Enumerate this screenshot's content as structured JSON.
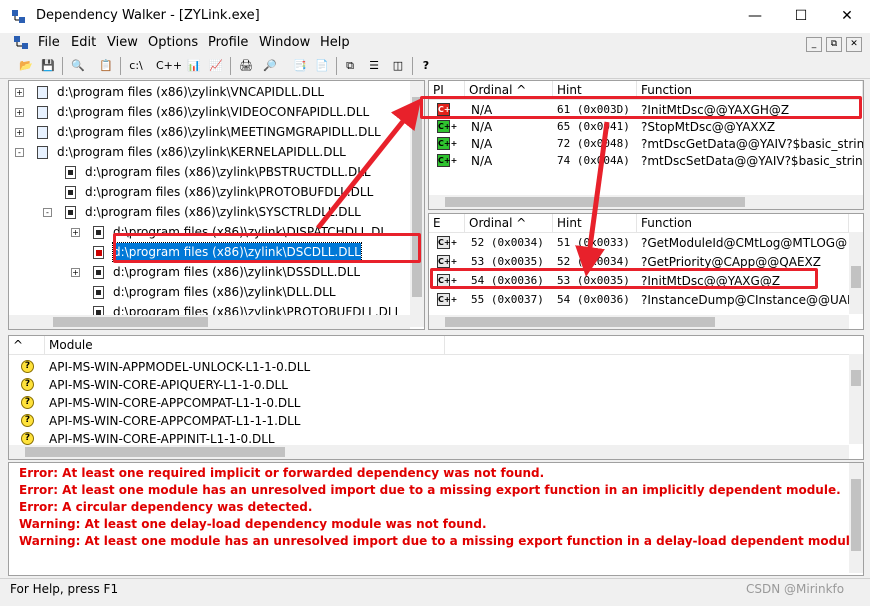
{
  "window": {
    "title": "Dependency Walker - [ZYLink.exe]",
    "minimize": "—",
    "maximize": "☐",
    "close": "✕"
  },
  "menu": [
    "File",
    "Edit",
    "View",
    "Options",
    "Profile",
    "Window",
    "Help"
  ],
  "mdi": {
    "min": "_",
    "restore": "⧉",
    "close": "✕"
  },
  "toolbar": [
    "📂",
    "💾",
    "🔍",
    "📋",
    "c:\\",
    "C++",
    "📊",
    "📈",
    "🖨",
    "🔎",
    "📑",
    "📄",
    "⧉",
    "☰",
    "◫",
    "?"
  ],
  "tree": [
    {
      "indent": 0,
      "exp": "+",
      "text": "d:\\program files (x86)\\zylink\\",
      "blur": "      ",
      "tail": "VNCAPIDLL.DLL"
    },
    {
      "indent": 0,
      "exp": "+",
      "text": "d:\\program files (x86)\\zylink\\",
      "blur": "      ",
      "tail": "VIDEOCONFAPIDLL.DLL"
    },
    {
      "indent": 0,
      "exp": "+",
      "text": "d:\\program files (x86)\\zylink\\",
      "blur": "      ",
      "tail": "MEETINGMGRAPIDLL.DLL"
    },
    {
      "indent": 0,
      "exp": "-",
      "text": "d:\\program files (x86)\\zylink\\",
      "blur": "      ",
      "tail": "KERNELAPIDLL.DLL"
    },
    {
      "indent": 1,
      "exp": "",
      "text": "d:\\program files (x86)\\zylink\\",
      "blur": "      ",
      "tail": "PBSTRUCTDLL.DLL"
    },
    {
      "indent": 1,
      "exp": "",
      "text": "d:\\program files (x86)\\zylink\\PROTOBUFDLL.DLL",
      "blur": "",
      "tail": ""
    },
    {
      "indent": 1,
      "exp": "-",
      "text": "d:\\program files (x86)\\zylink\\",
      "blur": "     ",
      "tail": "SYSCTRLDLL.DLL"
    },
    {
      "indent": 2,
      "exp": "+",
      "text": "d:\\program files (x86)\\zylink\\",
      "blur": "      ",
      "tail": "DISPATCHDLL.DL"
    },
    {
      "indent": 2,
      "exp": "",
      "text": "d:\\program files (x86)\\zylink\\",
      "blur": "    ",
      "tail": "DSCDLL.DLL",
      "selected": true
    },
    {
      "indent": 2,
      "exp": "+",
      "text": "d:\\program files (x86)\\zylink\\",
      "blur": "    ",
      "tail": "DSSDLL.DLL"
    },
    {
      "indent": 2,
      "exp": "",
      "text": "d:\\program files (x86)\\zylink\\",
      "blur": "    ",
      "tail": "DLL.DLL"
    },
    {
      "indent": 2,
      "exp": "",
      "text": "d:\\program files (x86)\\zylink\\PROTOBUFDLL.DLL",
      "blur": "",
      "tail": ""
    }
  ],
  "imports": {
    "headers": [
      "PI",
      "Ordinal ^",
      "Hint",
      "Function"
    ],
    "rows": [
      {
        "icon": "red",
        "ordinal": "N/A",
        "hint": "61 (0x003D)",
        "func": "?InitMtDsc@@YAXGH@Z"
      },
      {
        "icon": "green",
        "ordinal": "N/A",
        "hint": "65 (0x0041)",
        "func": "?StopMtDsc@@YAXXZ"
      },
      {
        "icon": "green",
        "ordinal": "N/A",
        "hint": "72 (0x0048)",
        "func": "?mtDscGetData@@YAIV?$basic_string"
      },
      {
        "icon": "green",
        "ordinal": "N/A",
        "hint": "74 (0x004A)",
        "func": "?mtDscSetData@@YAIV?$basic_string"
      }
    ]
  },
  "exports": {
    "headers": [
      "E",
      "Ordinal ^",
      "Hint",
      "Function"
    ],
    "rows": [
      {
        "ordinal": "52 (0x0034)",
        "hint": "51 (0x0033)",
        "func": "?GetModuleId@CMtLog@MTLOG@"
      },
      {
        "ordinal": "53 (0x0035)",
        "hint": "52 (0x0034)",
        "func": "?GetPriority@CApp@@QAEXZ"
      },
      {
        "ordinal": "54 (0x0036)",
        "hint": "53 (0x0035)",
        "func": "?InitMtDsc@@YAXG@Z"
      },
      {
        "ordinal": "55 (0x0037)",
        "hint": "54 (0x0036)",
        "func": "?InstanceDump@CInstance@@UAE"
      }
    ]
  },
  "modules": {
    "headers": [
      "^",
      "Module"
    ],
    "rows": [
      "API-MS-WIN-APPMODEL-UNLOCK-L1-1-0.DLL",
      "API-MS-WIN-CORE-APIQUERY-L1-1-0.DLL",
      "API-MS-WIN-CORE-APPCOMPAT-L1-1-0.DLL",
      "API-MS-WIN-CORE-APPCOMPAT-L1-1-1.DLL",
      "API-MS-WIN-CORE-APPINIT-L1-1-0.DLL"
    ]
  },
  "log": [
    "Error: At least one required implicit or forwarded dependency was not found.",
    "Error: At least one module has an unresolved import due to a missing export function in an implicitly dependent module.",
    "Error: A circular dependency was detected.",
    "Warning: At least one delay-load dependency module was not found.",
    "Warning: At least one module has an unresolved import due to a missing export function in a delay-load dependent module."
  ],
  "status": "For Help, press F1",
  "watermark": "CSDN @Mirinkfo",
  "colors": {
    "highlight_box": "#e8212b",
    "selection": "#0078d7",
    "error_text": "#e00000"
  }
}
